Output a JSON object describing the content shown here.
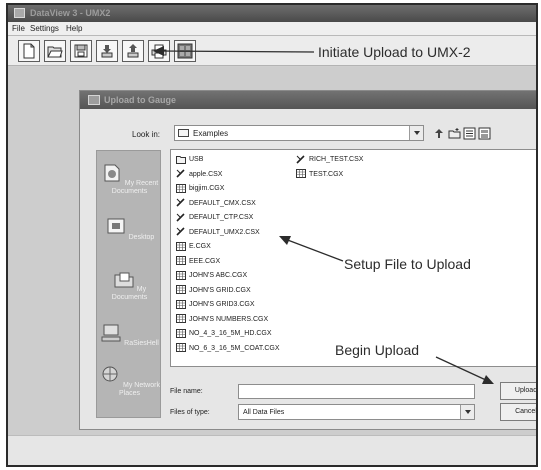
{
  "app": {
    "title": "DataView 3 - UMX2",
    "menu": [
      "File",
      "Settings",
      "Help"
    ]
  },
  "toolbar": {
    "buttons": [
      "new-icon",
      "open-icon",
      "save-icon",
      "download-icon",
      "upload-icon",
      "print-icon",
      "grid-icon"
    ]
  },
  "annotations": {
    "initiate_upload": "Initiate Upload to UMX-2",
    "setup_file": "Setup File to Upload",
    "begin_upload": "Begin Upload"
  },
  "dialog": {
    "title": "Upload to Gauge",
    "look_in_label": "Look in:",
    "look_in_value": "Examples",
    "places": [
      {
        "label": "My Recent Documents",
        "icon": "recent-documents-icon"
      },
      {
        "label": "Desktop",
        "icon": "desktop-icon"
      },
      {
        "label": "My Documents",
        "icon": "my-documents-icon"
      },
      {
        "label": "RaSiesHell",
        "icon": "computer-icon"
      },
      {
        "label": "My Network Places",
        "icon": "network-icon"
      }
    ],
    "files_col1": [
      {
        "name": "USB",
        "type": "folder"
      },
      {
        "name": "apple.CSX",
        "type": "csx"
      },
      {
        "name": "bigjim.CGX",
        "type": "cgx"
      },
      {
        "name": "DEFAULT_CMX.CSX",
        "type": "csx"
      },
      {
        "name": "DEFAULT_CTP.CSX",
        "type": "csx"
      },
      {
        "name": "DEFAULT_UMX2.CSX",
        "type": "csx"
      },
      {
        "name": "E.CGX",
        "type": "cgx"
      },
      {
        "name": "EEE.CGX",
        "type": "cgx"
      },
      {
        "name": "JOHN'S ABC.CGX",
        "type": "cgx"
      },
      {
        "name": "JOHN'S GRID.CGX",
        "type": "cgx"
      },
      {
        "name": "JOHN'S GRID3.CGX",
        "type": "cgx"
      },
      {
        "name": "JOHN'S NUMBERS.CGX",
        "type": "cgx"
      },
      {
        "name": "NO_4_3_16_5M_HD.CGX",
        "type": "cgx"
      },
      {
        "name": "NO_6_3_16_5M_COAT.CGX",
        "type": "cgx"
      }
    ],
    "files_col2": [
      {
        "name": "RICH_TEST.CSX",
        "type": "csx"
      },
      {
        "name": "TEST.CGX",
        "type": "cgx"
      }
    ],
    "file_name_label": "File name:",
    "file_name_value": "",
    "file_type_label": "Files of type:",
    "file_type_value": "All Data Files",
    "upload_button": "Upload",
    "cancel_button": "Cancel"
  }
}
